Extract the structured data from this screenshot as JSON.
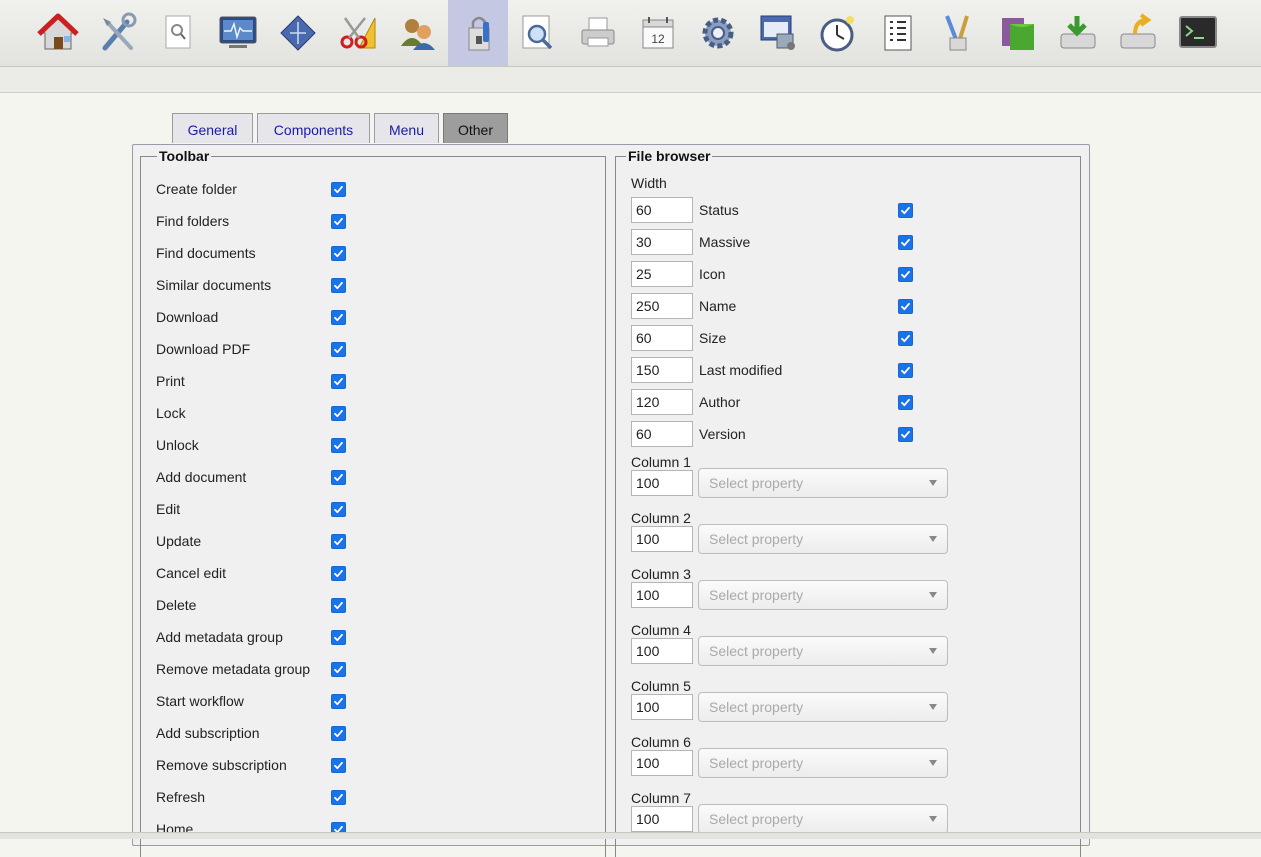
{
  "toolbar": {
    "icons": [
      "home-icon",
      "tools-icon",
      "document-search-icon",
      "monitor-icon",
      "diamond-icon",
      "scissors-ruler-icon",
      "users-icon",
      "locked-profile-icon",
      "magnifier-page-icon",
      "printer-icon",
      "calendar-icon",
      "gear-icon",
      "network-window-icon",
      "stopwatch-icon",
      "list-icon",
      "brushes-icon",
      "folder-green-icon",
      "import-drive-icon",
      "export-drive-icon",
      "terminal-icon"
    ],
    "calendar_day": "12",
    "active_index": 7
  },
  "tabs": [
    {
      "label": "General",
      "selected": false
    },
    {
      "label": "Components",
      "selected": false
    },
    {
      "label": "Menu",
      "selected": false
    },
    {
      "label": "Other",
      "selected": true
    }
  ],
  "toolbar_section": {
    "title": "Toolbar",
    "items": [
      {
        "label": "Create folder",
        "checked": true
      },
      {
        "label": "Find folders",
        "checked": true
      },
      {
        "label": "Find documents",
        "checked": true
      },
      {
        "label": "Similar documents",
        "checked": true
      },
      {
        "label": "Download",
        "checked": true
      },
      {
        "label": "Download PDF",
        "checked": true
      },
      {
        "label": "Print",
        "checked": true
      },
      {
        "label": "Lock",
        "checked": true
      },
      {
        "label": "Unlock",
        "checked": true
      },
      {
        "label": "Add document",
        "checked": true
      },
      {
        "label": "Edit",
        "checked": true
      },
      {
        "label": "Update",
        "checked": true
      },
      {
        "label": "Cancel edit",
        "checked": true
      },
      {
        "label": "Delete",
        "checked": true
      },
      {
        "label": "Add metadata group",
        "checked": true
      },
      {
        "label": "Remove metadata group",
        "checked": true
      },
      {
        "label": "Start workflow",
        "checked": true
      },
      {
        "label": "Add subscription",
        "checked": true
      },
      {
        "label": "Remove subscription",
        "checked": true
      },
      {
        "label": "Refresh",
        "checked": true
      },
      {
        "label": "Home",
        "checked": true
      }
    ]
  },
  "file_browser": {
    "title": "File browser",
    "width_label": "Width",
    "columns": [
      {
        "width": "60",
        "label": "Status",
        "checked": true
      },
      {
        "width": "30",
        "label": "Massive",
        "checked": true
      },
      {
        "width": "25",
        "label": "Icon",
        "checked": true
      },
      {
        "width": "250",
        "label": "Name",
        "checked": true
      },
      {
        "width": "60",
        "label": "Size",
        "checked": true
      },
      {
        "width": "150",
        "label": "Last modified",
        "checked": true
      },
      {
        "width": "120",
        "label": "Author",
        "checked": true
      },
      {
        "width": "60",
        "label": "Version",
        "checked": true
      }
    ],
    "extra_columns": [
      {
        "label": "Column 1",
        "width": "100",
        "placeholder": "Select property"
      },
      {
        "label": "Column 2",
        "width": "100",
        "placeholder": "Select property"
      },
      {
        "label": "Column 3",
        "width": "100",
        "placeholder": "Select property"
      },
      {
        "label": "Column 4",
        "width": "100",
        "placeholder": "Select property"
      },
      {
        "label": "Column 5",
        "width": "100",
        "placeholder": "Select property"
      },
      {
        "label": "Column 6",
        "width": "100",
        "placeholder": "Select property"
      },
      {
        "label": "Column 7",
        "width": "100",
        "placeholder": "Select property"
      }
    ]
  },
  "colors": {
    "accent": "#1a73e8",
    "tab_text": "#1a1aa8",
    "tab_selected_bg": "#9d9d9d",
    "toolbar_active_bg": "#c4c8e2"
  }
}
